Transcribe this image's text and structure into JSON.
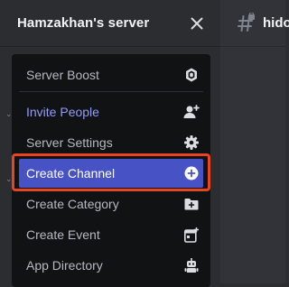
{
  "header": {
    "server_name": "Hamzakhan's server",
    "close_icon": "close-icon"
  },
  "channel": {
    "name": "hido",
    "icon": "hashtag-lock-icon"
  },
  "menu": {
    "items": [
      {
        "label": "Server Boost",
        "icon": "boost-gem-icon"
      },
      {
        "label": "Invite People",
        "icon": "add-person-icon",
        "accent": "#949cf7"
      },
      {
        "label": "Server Settings",
        "icon": "gear-icon"
      },
      {
        "label": "Create Channel",
        "icon": "plus-circle-icon",
        "active": true,
        "active_color": "#4752c4"
      },
      {
        "label": "Create Category",
        "icon": "folder-plus-icon"
      },
      {
        "label": "Create Event",
        "icon": "calendar-plus-icon"
      },
      {
        "label": "App Directory",
        "icon": "robot-icon"
      }
    ],
    "highlight_color": "#e8441f"
  }
}
